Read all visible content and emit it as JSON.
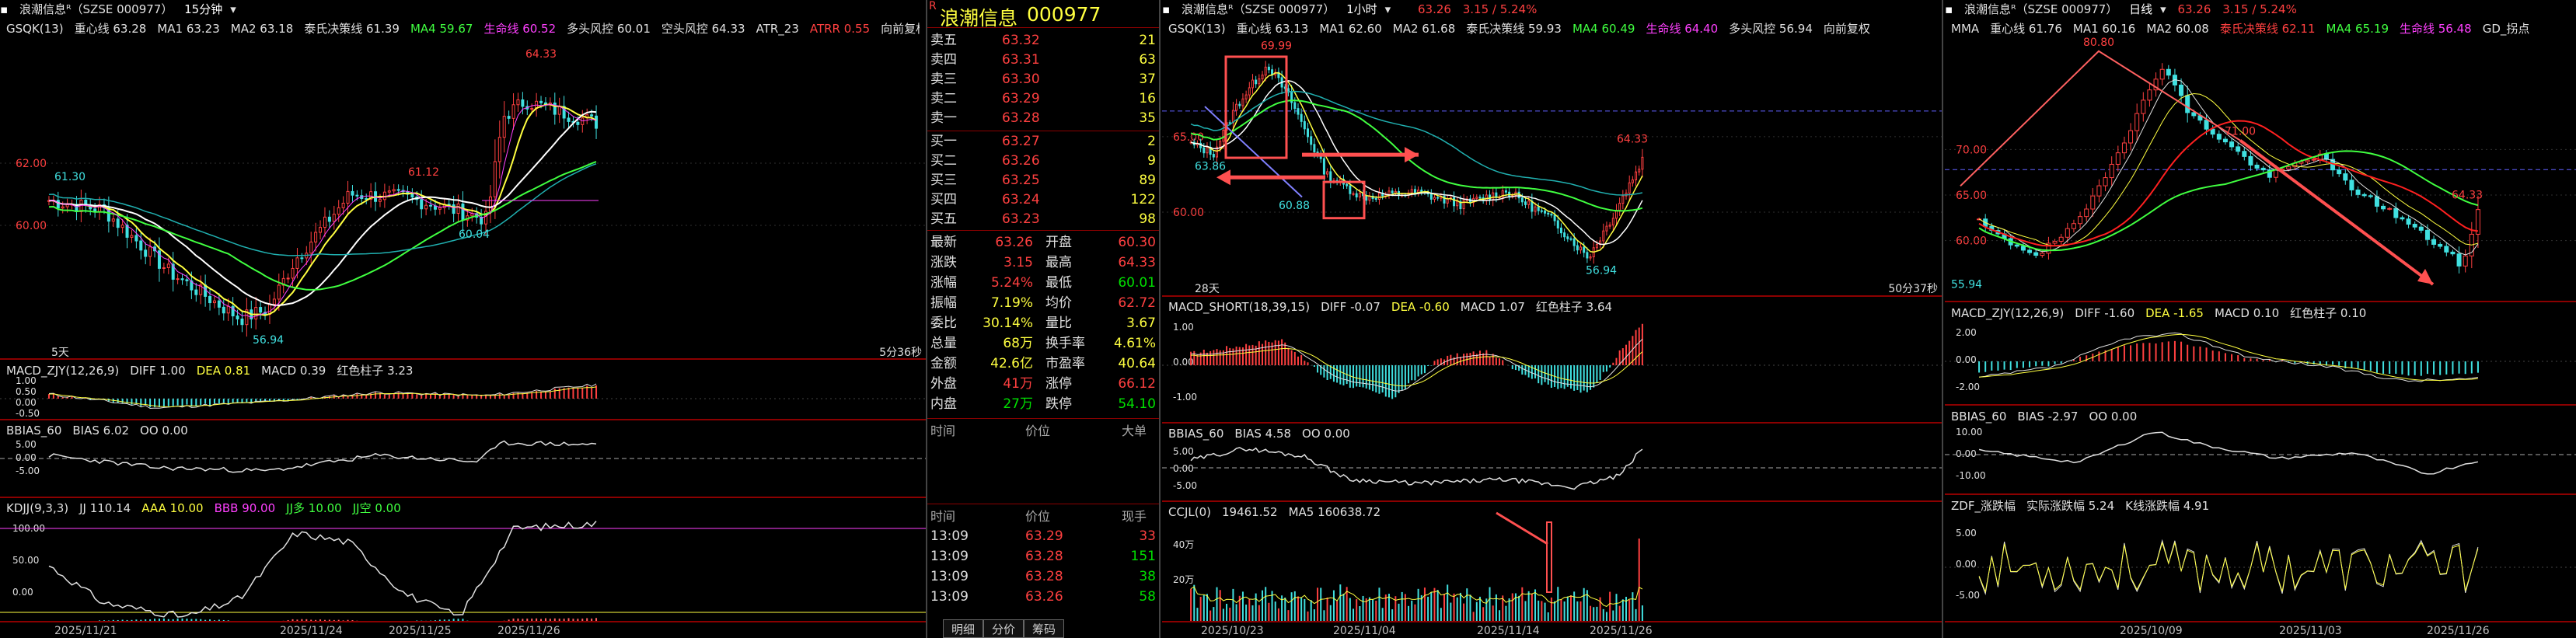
{
  "left": {
    "title": "浪潮信息ᴿ（SZSE 000977）",
    "period": "15分钟",
    "main": [
      {
        "t": "GSQK(13)",
        "c": "#e0e0e0"
      },
      {
        "t": "重心线 63.28",
        "c": "#e0e0e0"
      },
      {
        "t": "MA1 63.23",
        "c": "#e0e0e0"
      },
      {
        "t": "MA2 63.18",
        "c": "#e0e0e0"
      },
      {
        "t": "泰氏决策线 61.39",
        "c": "#e0e0e0"
      },
      {
        "t": "MA4 59.67",
        "c": "#40ff40"
      },
      {
        "t": "生命线 60.52",
        "c": "#ff40ff"
      },
      {
        "t": "多头风控 60.01",
        "c": "#e0e0e0"
      },
      {
        "t": "空头风控 64.33",
        "c": "#e0e0e0"
      },
      {
        "t": "ATR_23",
        "c": "#e0e0e0"
      },
      {
        "t": "ATRR 0.55",
        "c": "#ff4040"
      },
      {
        "t": "向前复权",
        "c": "#e0e0e0"
      }
    ],
    "yticks": [
      "62.00",
      "60.00"
    ],
    "price_labels": {
      "high": "64.33",
      "p61_12": "61.12",
      "p61_30": "61.30",
      "p60_04": "60.04",
      "low": "56.94"
    },
    "days_label": "5天",
    "countdown": "5分36秒",
    "macd": [
      {
        "t": "MACD_ZJY(12,26,9)",
        "c": "#e0e0e0"
      },
      {
        "t": "DIFF 1.00",
        "c": "#e0e0e0"
      },
      {
        "t": "DEA 0.81",
        "c": "#ffff40"
      },
      {
        "t": "MACD 0.39",
        "c": "#e0e0e0"
      },
      {
        "t": "红色柱子 3.23",
        "c": "#e0e0e0"
      }
    ],
    "macd_ticks": [
      "1.00",
      "0.50",
      "0.00",
      "-0.50"
    ],
    "bbias": [
      {
        "t": "BBIAS_60",
        "c": "#e0e0e0"
      },
      {
        "t": "BIAS 6.02",
        "c": "#e0e0e0"
      },
      {
        "t": "OO 0.00",
        "c": "#e0e0e0"
      }
    ],
    "bbias_ticks": [
      "5.00",
      "0.00",
      "-5.00"
    ],
    "kdj": [
      {
        "t": "KDJJ(9,3,3)",
        "c": "#e0e0e0"
      },
      {
        "t": "JJ 110.14",
        "c": "#e0e0e0"
      },
      {
        "t": "AAA 10.00",
        "c": "#ffff40"
      },
      {
        "t": "BBB 90.00",
        "c": "#ff40ff"
      },
      {
        "t": "JJ多 10.00",
        "c": "#40ff40"
      },
      {
        "t": "JJ空 0.00",
        "c": "#40ff40"
      }
    ],
    "kdj_ticks": [
      "100.00",
      "50.00",
      "0.00"
    ],
    "dates": [
      "2025/11/21",
      "2025/11/24",
      "2025/11/25",
      "2025/11/26"
    ]
  },
  "quote": {
    "r_icon": "R",
    "name": "浪潮信息",
    "code": "000977",
    "asks": [
      {
        "l": "卖五",
        "p": "63.32",
        "v": "21"
      },
      {
        "l": "卖四",
        "p": "63.31",
        "v": "63"
      },
      {
        "l": "卖三",
        "p": "63.30",
        "v": "37"
      },
      {
        "l": "卖二",
        "p": "63.29",
        "v": "16"
      },
      {
        "l": "卖一",
        "p": "63.28",
        "v": "35"
      }
    ],
    "bids": [
      {
        "l": "买一",
        "p": "63.27",
        "v": "2"
      },
      {
        "l": "买二",
        "p": "63.26",
        "v": "9"
      },
      {
        "l": "买三",
        "p": "63.25",
        "v": "89"
      },
      {
        "l": "买四",
        "p": "63.24",
        "v": "122"
      },
      {
        "l": "买五",
        "p": "63.23",
        "v": "98"
      }
    ],
    "stats": [
      {
        "a": "最新",
        "av": "63.26",
        "ac": "r",
        "b": "开盘",
        "bv": "60.30",
        "bc": "r"
      },
      {
        "a": "涨跌",
        "av": "3.15",
        "ac": "r",
        "b": "最高",
        "bv": "64.33",
        "bc": "r"
      },
      {
        "a": "涨幅",
        "av": "5.24%",
        "ac": "r",
        "b": "最低",
        "bv": "60.01",
        "bc": "g"
      },
      {
        "a": "振幅",
        "av": "7.19%",
        "ac": "y",
        "b": "均价",
        "bv": "62.72",
        "bc": "r"
      },
      {
        "a": "委比",
        "av": "30.14%",
        "ac": "y",
        "b": "量比",
        "bv": "3.67",
        "bc": "y"
      },
      {
        "a": "总量",
        "av": "68万",
        "ac": "y",
        "b": "换手率",
        "bv": "4.61%",
        "bc": "y"
      },
      {
        "a": "金额",
        "av": "42.6亿",
        "ac": "y",
        "b": "市盈率",
        "bv": "40.64",
        "bc": "y"
      },
      {
        "a": "外盘",
        "av": "41万",
        "ac": "r",
        "b": "涨停",
        "bv": "66.12",
        "bc": "r"
      },
      {
        "a": "内盘",
        "av": "27万",
        "ac": "g",
        "b": "跌停",
        "bv": "54.10",
        "bc": "g"
      }
    ],
    "tick_head": {
      "t": "时间",
      "p": "价位",
      "v": "大单"
    },
    "tick_head2": {
      "t": "时间",
      "p": "价位",
      "v": "现手"
    },
    "ticks": [
      {
        "t": "13:09",
        "p": "63.29",
        "v": "33",
        "vc": "r"
      },
      {
        "t": "13:09",
        "p": "63.28",
        "v": "151",
        "vc": "g"
      },
      {
        "t": "13:09",
        "p": "63.28",
        "v": "38",
        "vc": "g"
      },
      {
        "t": "13:09",
        "p": "63.26",
        "v": "58",
        "vc": "g"
      }
    ],
    "tabs": [
      "明细",
      "分价",
      "筹码"
    ]
  },
  "mid": {
    "title": "浪潮信息ᴿ（SZSE 000977）",
    "period": "1小时",
    "price": "63.26",
    "change": "3.15 / 5.24%",
    "main": [
      {
        "t": "GSQK(13)",
        "c": "#e0e0e0"
      },
      {
        "t": "重心线 63.13",
        "c": "#e0e0e0"
      },
      {
        "t": "MA1 62.60",
        "c": "#e0e0e0"
      },
      {
        "t": "MA2 61.68",
        "c": "#e0e0e0"
      },
      {
        "t": "泰氏决策线 59.93",
        "c": "#e0e0e0"
      },
      {
        "t": "MA4 60.49",
        "c": "#40ff40"
      },
      {
        "t": "生命线 64.40",
        "c": "#ff40ff"
      },
      {
        "t": "多头风控 56.94",
        "c": "#e0e0e0"
      },
      {
        "t": "向前复权",
        "c": "#e0e0e0"
      }
    ],
    "yticks": [
      "65.00",
      "60.00"
    ],
    "price_labels": {
      "top": "69.99",
      "p64_33": "64.33",
      "p63_86": "63.86",
      "p60_88": "60.88",
      "low": "56.94"
    },
    "days_label": "28天",
    "countdown": "50分37秒",
    "macd": [
      {
        "t": "MACD_SHORT(18,39,15)",
        "c": "#e0e0e0"
      },
      {
        "t": "DIFF -0.07",
        "c": "#e0e0e0"
      },
      {
        "t": "DEA -0.60",
        "c": "#ffff40"
      },
      {
        "t": "MACD 1.07",
        "c": "#e0e0e0"
      },
      {
        "t": "红色柱子 3.64",
        "c": "#e0e0e0"
      }
    ],
    "macd_ticks": [
      "1.00",
      "0.00",
      "-1.00"
    ],
    "bbias": [
      {
        "t": "BBIAS_60",
        "c": "#e0e0e0"
      },
      {
        "t": "BIAS 4.58",
        "c": "#e0e0e0"
      },
      {
        "t": "OO 0.00",
        "c": "#e0e0e0"
      }
    ],
    "bbias_ticks": [
      "5.00",
      "0.00",
      "-5.00"
    ],
    "cc": [
      {
        "t": "CCJL(0)",
        "c": "#e0e0e0"
      },
      {
        "t": "19461.52",
        "c": "#e0e0e0"
      },
      {
        "t": "MA5 160638.72",
        "c": "#e0e0e0"
      }
    ],
    "cc_ticks": [
      "40万",
      "20万"
    ],
    "dates": [
      "2025/10/23",
      "2025/11/04",
      "2025/11/14",
      "2025/11/26"
    ]
  },
  "right": {
    "title": "浪潮信息ᴿ（SZSE 000977）",
    "period": "日线",
    "price": "63.26",
    "change": "3.15 / 5.24%",
    "main": [
      {
        "t": "MMA",
        "c": "#e0e0e0"
      },
      {
        "t": "重心线 61.76",
        "c": "#e0e0e0"
      },
      {
        "t": "MA1 60.16",
        "c": "#e0e0e0"
      },
      {
        "t": "MA2 60.08",
        "c": "#e0e0e0"
      },
      {
        "t": "泰氏决策线 62.11",
        "c": "#ff4040"
      },
      {
        "t": "MA4 65.19",
        "c": "#40ff40"
      },
      {
        "t": "生命线 56.48",
        "c": "#ff40ff"
      },
      {
        "t": "GD_拐点",
        "c": "#e0e0e0"
      }
    ],
    "yticks": [
      "70.00",
      "65.00",
      "60.00"
    ],
    "price_labels": {
      "top": "80.80",
      "p71": "71.00",
      "p64_33": "64.33",
      "low": "55.94"
    },
    "macd": [
      {
        "t": "MACD_ZJY(12,26,9)",
        "c": "#e0e0e0"
      },
      {
        "t": "DIFF -1.60",
        "c": "#e0e0e0"
      },
      {
        "t": "DEA -1.65",
        "c": "#ffff40"
      },
      {
        "t": "MACD 0.10",
        "c": "#e0e0e0"
      },
      {
        "t": "红色柱子 0.10",
        "c": "#e0e0e0"
      }
    ],
    "macd_ticks": [
      "2.00",
      "0.00",
      "-2.00"
    ],
    "bbias": [
      {
        "t": "BBIAS_60",
        "c": "#e0e0e0"
      },
      {
        "t": "BIAS -2.97",
        "c": "#e0e0e0"
      },
      {
        "t": "OO 0.00",
        "c": "#e0e0e0"
      }
    ],
    "bbias_ticks": [
      "10.00",
      "0.00",
      "-10.00"
    ],
    "zdf": [
      {
        "t": "ZDF_涨跌幅",
        "c": "#e0e0e0"
      },
      {
        "t": "实际涨跌幅 5.24",
        "c": "#e0e0e0"
      },
      {
        "t": "K线涨跌幅 4.91",
        "c": "#e0e0e0"
      }
    ],
    "zdf_ticks": [
      "5.00",
      "0.00",
      "-5.00"
    ],
    "dates": [
      "2025/10/09",
      "2025/11/03",
      "2025/11/26"
    ]
  }
}
